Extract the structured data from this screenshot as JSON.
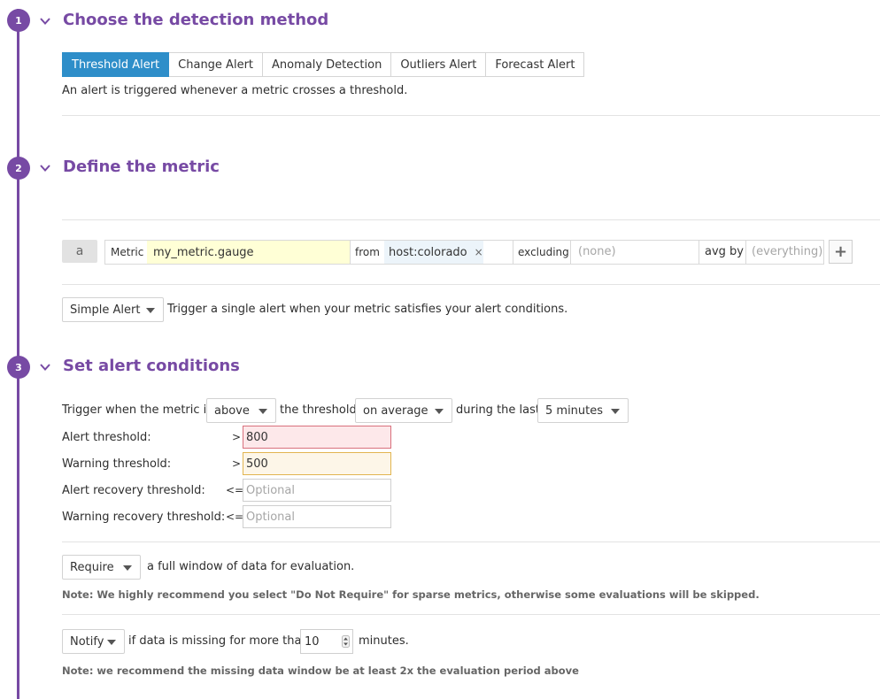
{
  "sections": [
    {
      "number": "1",
      "title": "Choose the detection method"
    },
    {
      "number": "2",
      "title": "Define the metric"
    },
    {
      "number": "3",
      "title": "Set alert conditions"
    }
  ],
  "detection": {
    "tabs": [
      "Threshold Alert",
      "Change Alert",
      "Anomaly Detection",
      "Outliers Alert",
      "Forecast Alert"
    ],
    "active_tab": "Threshold Alert",
    "description": "An alert is triggered whenever a metric crosses a threshold."
  },
  "metric": {
    "query_letter": "a",
    "metric_label": "Metric",
    "metric_value": "my_metric.gauge",
    "from_label": "from",
    "from_tag": "host:colorado",
    "remove_symbol": "×",
    "excluding_label": "excluding",
    "excluding_placeholder": "(none)",
    "avg_by_label": "avg by",
    "avg_by_placeholder": "(everything)",
    "add_symbol": "+",
    "alert_type": "Simple Alert",
    "alert_type_desc": "Trigger a single alert when your metric satisfies your alert conditions."
  },
  "conditions": {
    "trigger_prefix": "Trigger when the metric is",
    "comparison": "above",
    "threshold_text": "the threshold",
    "aggregation": "on average",
    "during_text": "during the last",
    "window": "5 minutes",
    "rows": [
      {
        "label": "Alert threshold:",
        "op": ">",
        "value": "800",
        "placeholder": ""
      },
      {
        "label": "Warning threshold:",
        "op": ">",
        "value": "500",
        "placeholder": ""
      },
      {
        "label": "Alert recovery threshold:",
        "op": "<=",
        "value": "",
        "placeholder": "Optional"
      },
      {
        "label": "Warning recovery threshold:",
        "op": "<=",
        "value": "",
        "placeholder": "Optional"
      }
    ],
    "require_option": "Require",
    "require_text": "a full window of data for evaluation.",
    "require_note": "Note: We highly recommend you select \"Do Not Require\" for sparse metrics, otherwise some evaluations will be skipped.",
    "notify_option": "Notify",
    "notify_text": "if data is missing for more than",
    "notify_minutes": "10",
    "notify_unit": "minutes.",
    "notify_note": "Note: we recommend the missing data window be at least 2x the evaluation period above"
  },
  "colors": {
    "accent": "#774aa4",
    "active_tab": "#2e8ec9",
    "alert_bg": "#fde8ea",
    "warning_bg": "#fdf6e8",
    "metric_bg": "#ffffd6",
    "tag_bg": "#ecf4fa"
  }
}
